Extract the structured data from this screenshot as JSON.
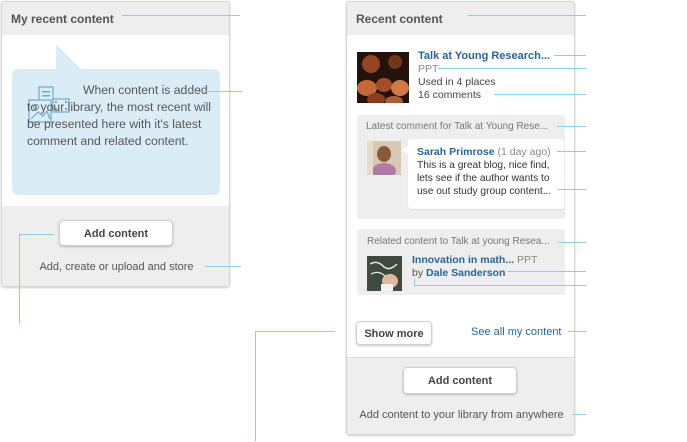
{
  "left_widget": {
    "title": "My recent content",
    "empty_message": "When content is added to your library, the most recent will be presented here with it's latest comment and related content.",
    "add_button": "Add content",
    "add_hint": "Add, create or upload and store"
  },
  "right_widget": {
    "title": "Recent content",
    "item": {
      "title": "Talk at Young Research...",
      "type": "PPT",
      "used": "Used in 4 places",
      "comments": "16 comments"
    },
    "latest_comment": {
      "header": "Latest comment for Talk at Young Rese...",
      "author": "Sarah Primrose",
      "time": "(1 day ago)",
      "text": "This is a great blog, nice find, lets see if the author wants to use out study group content..."
    },
    "related": {
      "header": "Related content to Talk at young Resea...",
      "title": "Innovation in math...",
      "type": "PPT",
      "by": "by",
      "author": "Dale Sanderson"
    },
    "show_more": "Show more",
    "see_all": "See all my content",
    "add_button": "Add content",
    "add_hint": "Add content to your library from anywhere"
  },
  "colors": {
    "annotation_line": "#8fcde0",
    "link": "#2a6496",
    "bubble": "#daedf7",
    "panel_gray": "#eeeeee"
  }
}
